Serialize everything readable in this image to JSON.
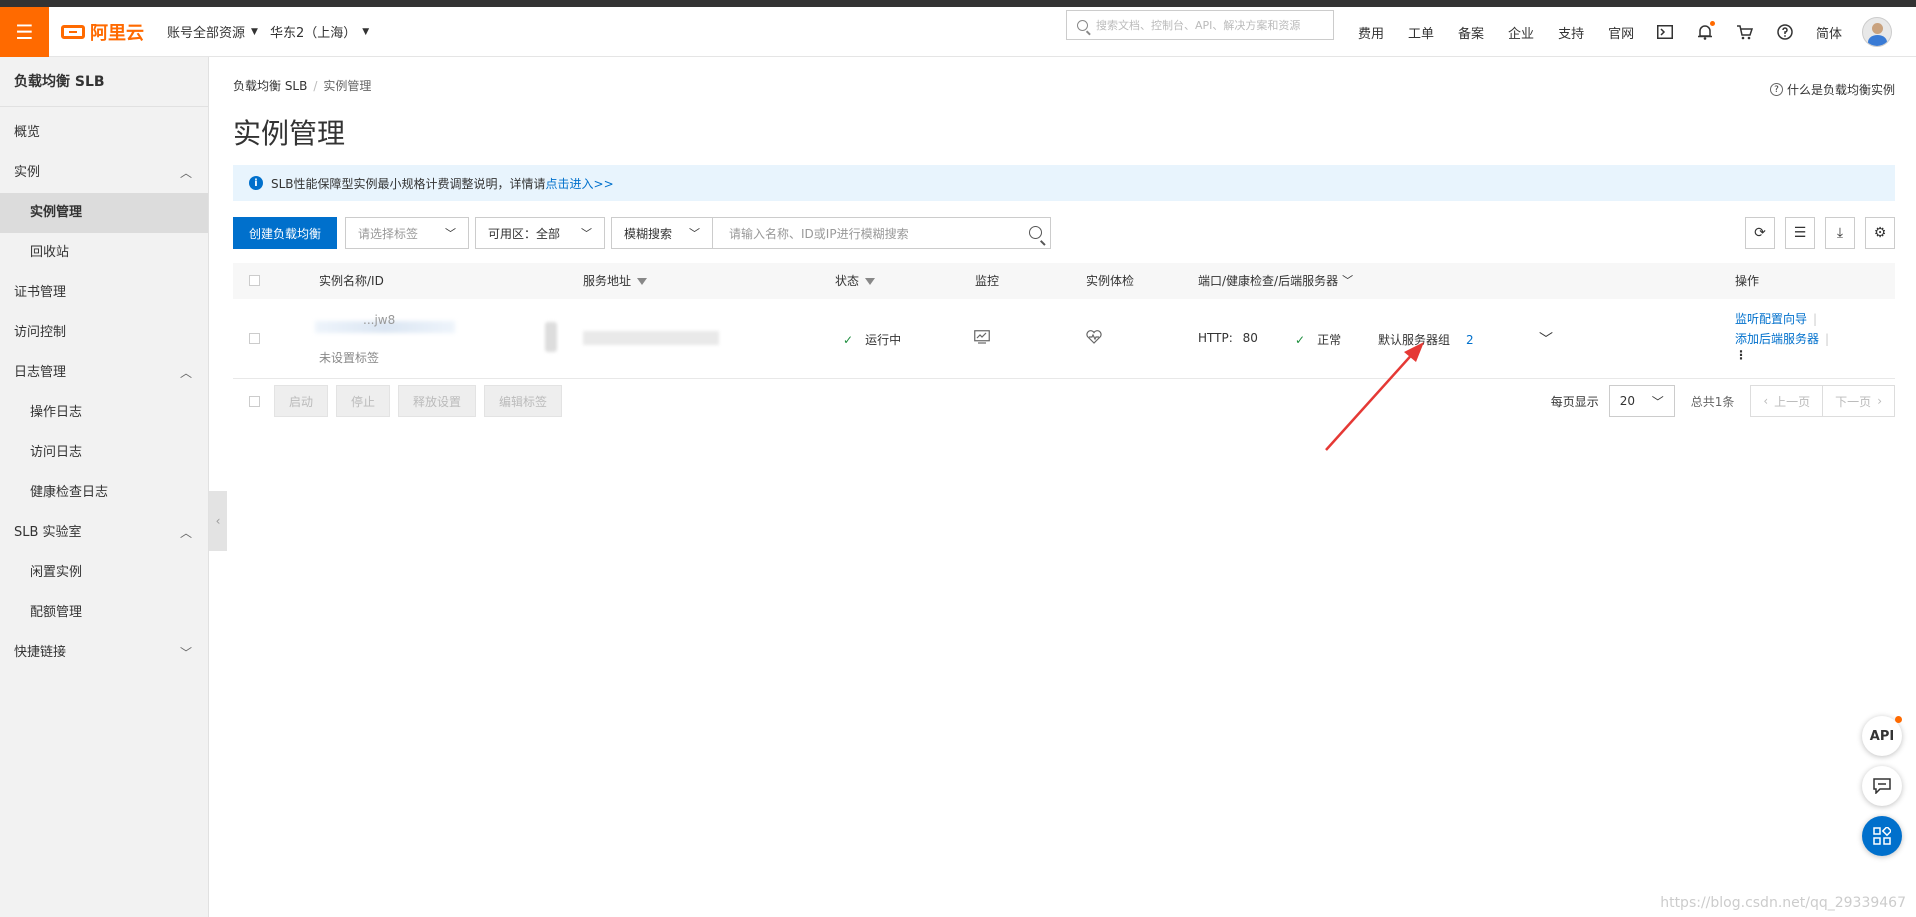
{
  "topbar": {
    "logo": "阿里云",
    "account_scope": "账号全部资源",
    "region": "华东2（上海）",
    "search_placeholder": "搜索文档、控制台、API、解决方案和资源",
    "links": [
      "费用",
      "工单",
      "备案",
      "企业",
      "支持",
      "官网"
    ],
    "language": "简体",
    "icons": [
      "terminal-icon",
      "bell-icon",
      "cart-icon",
      "help-icon"
    ]
  },
  "sidebar": {
    "title": "负载均衡 SLB",
    "items": [
      {
        "label": "概览",
        "level": 1
      },
      {
        "label": "实例",
        "level": 1,
        "expanded": true
      },
      {
        "label": "实例管理",
        "level": 2,
        "active": true
      },
      {
        "label": "回收站",
        "level": 2
      },
      {
        "label": "证书管理",
        "level": 1
      },
      {
        "label": "访问控制",
        "level": 1
      },
      {
        "label": "日志管理",
        "level": 1,
        "expanded": true
      },
      {
        "label": "操作日志",
        "level": 2
      },
      {
        "label": "访问日志",
        "level": 2
      },
      {
        "label": "健康检查日志",
        "level": 2
      },
      {
        "label": "SLB 实验室",
        "level": 1,
        "expanded": true
      },
      {
        "label": "闲置实例",
        "level": 2
      },
      {
        "label": "配额管理",
        "level": 2
      },
      {
        "label": "快捷链接",
        "level": 1,
        "expanded": false
      }
    ]
  },
  "breadcrumb": {
    "root": "负载均衡 SLB",
    "separator": "/",
    "current": "实例管理"
  },
  "help_link": "什么是负载均衡实例",
  "page_title": "实例管理",
  "notice": {
    "text": "SLB性能保障型实例最小规格计费调整说明，详情请",
    "link": "点击进入>>"
  },
  "toolbar": {
    "create_button": "创建负载均衡",
    "tag_select_placeholder": "请选择标签",
    "zone_select": "可用区：全部",
    "search_mode": "模糊搜索",
    "search_placeholder": "请输入名称、ID或IP进行模糊搜索"
  },
  "table": {
    "columns": [
      "实例名称/ID",
      "服务地址",
      "状态",
      "监控",
      "实例体检",
      "端口/健康检查/后端服务器",
      "操作"
    ],
    "rows": [
      {
        "name": "...jw8",
        "tag": "未设置标签",
        "status": "运行中",
        "protocol": "HTTP:",
        "port": "80",
        "health": "正常",
        "server_group": "默认服务器组",
        "server_count": "2",
        "actions": [
          "监听配置向导",
          "添加后端服务器"
        ]
      }
    ]
  },
  "bulk_actions": [
    "启动",
    "停止",
    "释放设置",
    "编辑标签"
  ],
  "pagination": {
    "per_page_label": "每页显示",
    "per_page": "20",
    "total": "总共1条",
    "prev": "上一页",
    "next": "下一页"
  },
  "floating": {
    "api": "API"
  },
  "watermark": "https://blog.csdn.net/qq_29339467"
}
